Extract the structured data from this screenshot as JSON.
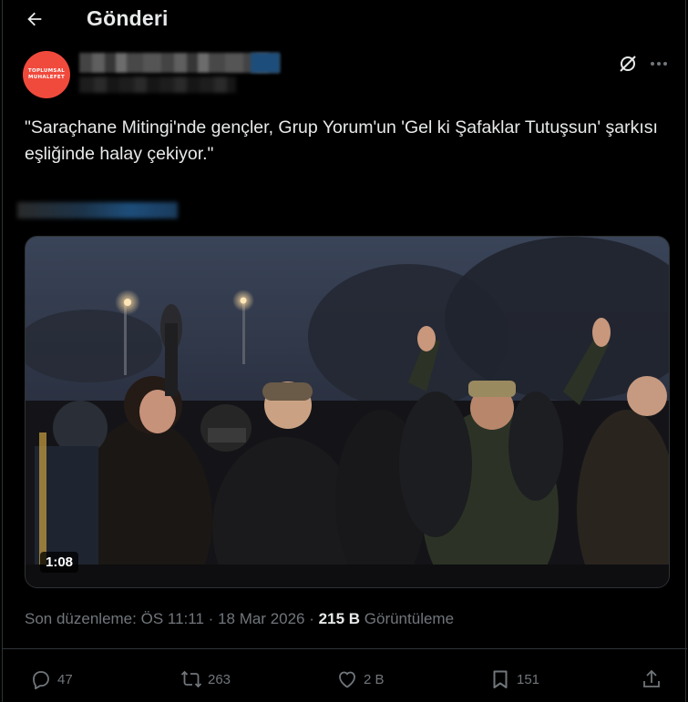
{
  "header": {
    "title": "Gönderi"
  },
  "author": {
    "avatar_line1": "TOPLUMSAL",
    "avatar_line2": "MUHALEFET"
  },
  "post": {
    "text": "\"Saraçhane Mitingi'nde gençler, Grup Yorum'un 'Gel ki Şafaklar Tutuşsun' şarkısı eşliğinde halay çekiyor.\"",
    "video_duration": "1:08"
  },
  "meta": {
    "edited_prefix": "Son düzenleme:",
    "time": "ÖS 11:11",
    "separator": "·",
    "date": "18 Mar 2026",
    "views_count": "215 B",
    "views_label": "Görüntüleme"
  },
  "actions": {
    "replies": "47",
    "reposts": "263",
    "likes": "2 B",
    "bookmarks": "151"
  },
  "colors": {
    "background": "#000000",
    "text_primary": "#e7e9ea",
    "text_secondary": "#71767b",
    "border": "#2f3336",
    "avatar": "#f04a3c"
  }
}
